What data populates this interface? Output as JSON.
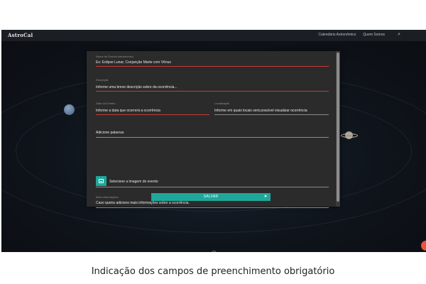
{
  "header": {
    "brand": "AstroCal",
    "nav": [
      "Calendário Astronômico",
      "Quem Somos"
    ]
  },
  "form": {
    "name": {
      "label": "Nome do Evento Astronômico",
      "value": "Ex: Eclipse Lunar, Conjunção Marte com Vênus"
    },
    "description": {
      "label": "Descrição",
      "value": "Informe uma breve descrição sobre da ocorrência..."
    },
    "date": {
      "label": "Data do Evento",
      "value": "Informe a data que ocorrerá a ocorrência"
    },
    "location": {
      "label": "Localização",
      "value": "Informe em quais locais será possível visualizar ocorrência"
    },
    "keywords": {
      "value": "Adicione palavras"
    },
    "image": {
      "value": "Selecione a imagem do evento"
    },
    "more_info": {
      "label": "Mais Informações",
      "value": "Caso queira adicione mais informações sobre a ocorrência."
    },
    "save_label": "SALVAR"
  },
  "caption": "Indicação dos campos de preenchimento obrigatório",
  "colors": {
    "accent": "#1fa89a",
    "required": "#c43b3b",
    "modal": "#2b2b2b"
  }
}
